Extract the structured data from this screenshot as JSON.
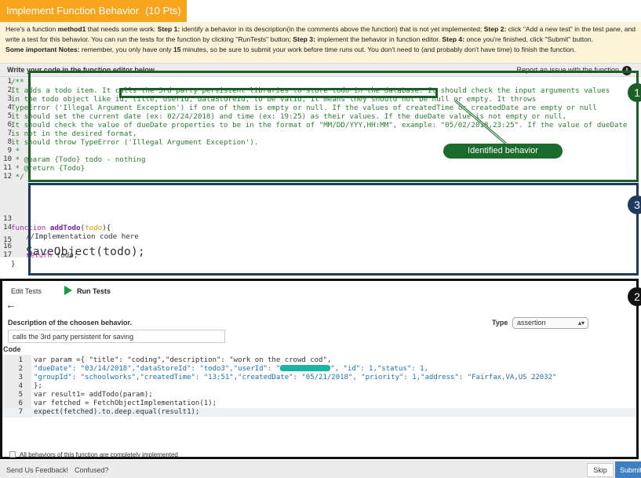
{
  "task": {
    "title": "Implement Function Behavior",
    "points": "(10 Pts)"
  },
  "instructions": {
    "intro": "Here's a function ",
    "method": "method1",
    "step1_pre": " that needs some work. ",
    "step1_label": "Step 1:",
    "step1_text": " identify a behavior in its description(in the comments above the function) that is not yet implemented; ",
    "step2_label": "Step 2:",
    "step2_text": " click \"Add a new test\" in the test pane, and write a test for this behavior. You can run the tests for the function by clicking \"RunTests\" button; ",
    "step3_label": "Step 3:",
    "step3_text": " implement the behavior in function editor. ",
    "step4_label": "Step 4:",
    "step4_text": " once you're finished, click \"Submit\" button.",
    "notes_label": "Some important Notes:",
    "notes_pre": " remember, you only have only ",
    "notes_minutes": "15",
    "notes_post": " minutes, so be sure to submit your work before time runs out. You don't need to (and probably don't have time) to finish the function."
  },
  "editor_header": {
    "title": "Write your code in the function editor below",
    "report_link": "Report an issue with the function",
    "alert_icon": "!"
  },
  "editor": {
    "lines": [
      {
        "n": "1",
        "text": "/**"
      },
      {
        "n": "2",
        "text": "It adds a todo item. It calls the 3rd party persistent libraries to store todo in the database. It should check the input arguments values"
      },
      {
        "n": "3",
        "text": "in the todo object like id, title, userId, dataStoreId, to be valid, it means they should not be null or empty. It throws"
      },
      {
        "n": "4",
        "text": "TypeError ('Illegal Argument Exception') if one of them is empty or null. If the values of createdTime or createdDate are empty or null"
      },
      {
        "n": "5",
        "text": "it should set the current date (ex: 02/24/2018) and time (ex: 19:25) as their values. If the dueDate value is not empty or null,"
      },
      {
        "n": "6",
        "text": "It should check the value of dueDate properties to be in the format of \"MM/DD/YYY,HH:MM\", example: \"05/02/2018,23:25\". If the value of dueDate"
      },
      {
        "n": "7",
        "text": "is not in the desired format,"
      },
      {
        "n": "8",
        "text": "it should throw TypeError ('Illegal Argument Exception')."
      },
      {
        "n": "9",
        "text": " *"
      },
      {
        "n": "10",
        "text": " * @param {Todo} todo - nothing"
      },
      {
        "n": "11",
        "text": " * @return {Todo}"
      },
      {
        "n": "12",
        "text": " */"
      }
    ],
    "fn_keyword": "function",
    "fn_name": "addTodo",
    "fn_param": "todo",
    "fn_open": "){",
    "impl_comment": "//Implementation code here",
    "save_call": "SaveObject(todo);",
    "return_kw": "return",
    "return_val": " todo;",
    "close": "}",
    "ln13": "13",
    "ln14": "14",
    "ln15": "15",
    "ln16": "16",
    "ln17": "17"
  },
  "annotations": {
    "badge1": "1",
    "badge2": "2",
    "badge3": "3",
    "callout": "Identified behavior"
  },
  "tests": {
    "tab_edit": "Edit Tests",
    "tab_run": "Run Tests",
    "desc_label": "Description of the choosen behavior.",
    "desc_value": "calls the 3rd party persistent for saving",
    "type_label": "Type",
    "type_value": "assertion",
    "code_label": "Code",
    "lines": [
      {
        "n": "1",
        "text": "var param ={ \"title\": \"coding\",\"description\": \"work on the crowd cod\","
      },
      {
        "n": "2",
        "text_a": "\"dueDate\": \"03/14/2018\",\"dataStoreId\": \"todo3\",\"userId\": \"",
        "text_b": "\", \"id\": 1,\"status\": 1,"
      },
      {
        "n": "3",
        "text": "\"groupId\": \"schoolworks\",\"createdTime\": \"13:51\",\"createdDate\": \"05/21/2018\", \"priority\": 1,\"address\": \"Fairfax,VA,US 22032\""
      },
      {
        "n": "4",
        "text": "};"
      },
      {
        "n": "5",
        "text": "var result1= addTodo(param);"
      },
      {
        "n": "6",
        "text": "var fetched = FetchObjectImplementation(1);"
      },
      {
        "n": "7",
        "text": "expect(fetched).to.deep.equal(result1);"
      }
    ]
  },
  "footer": {
    "all_implemented": "All behaviors of this function are completely implemented",
    "feedback": "Send Us Feedback!",
    "confused": "Confused?",
    "skip": "Skip",
    "submit": "Submit"
  }
}
